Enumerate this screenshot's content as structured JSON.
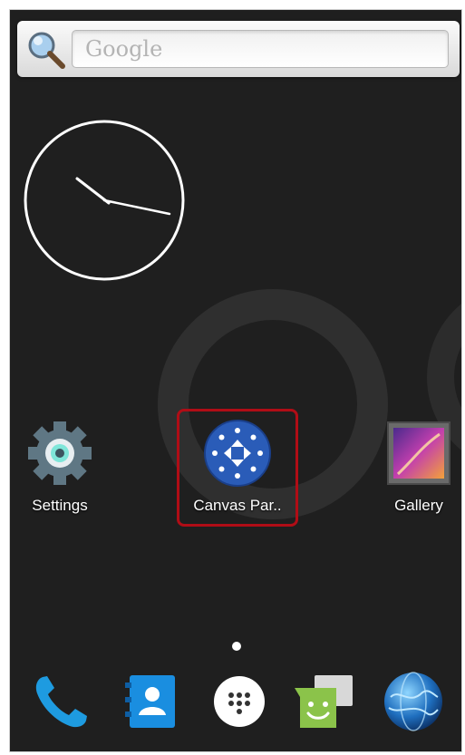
{
  "search": {
    "placeholder": "Google"
  },
  "apps": [
    {
      "label": "Settings",
      "icon": "settings-gear-icon"
    },
    {
      "label": "Canvas Par..",
      "icon": "canvas-parent-icon"
    },
    {
      "label": "Gallery",
      "icon": "gallery-icon"
    }
  ],
  "dock": [
    {
      "icon": "phone-icon"
    },
    {
      "icon": "contacts-icon"
    },
    {
      "icon": "app-drawer-icon"
    },
    {
      "icon": "messaging-icon"
    },
    {
      "icon": "browser-globe-icon"
    }
  ],
  "colors": {
    "background": "#1f1f1f",
    "highlight": "#b00d16",
    "canvas_blue": "#2a5cb8"
  }
}
